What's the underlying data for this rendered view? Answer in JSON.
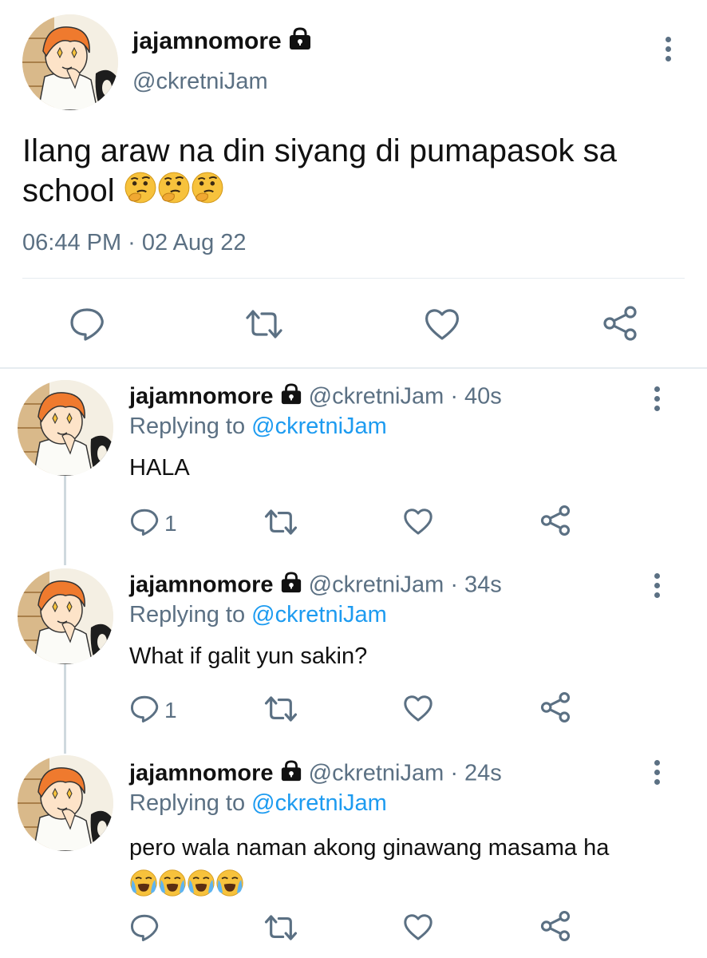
{
  "main_tweet": {
    "display_name": "jajamnomore",
    "handle": "@ckretniJam",
    "text_line1": "Ilang araw na din siyang di pumapasok sa",
    "text_line2": "school",
    "emoji": "thinking-face",
    "emoji_count": 3,
    "timestamp": "06:44 PM · 02 Aug 22",
    "actions": [
      "reply-icon",
      "retweet-icon",
      "like-icon",
      "share-icon"
    ]
  },
  "replies": [
    {
      "display_name": "jajamnomore",
      "meta": "@ckretniJam · 40s",
      "replying_prefix": "Replying to",
      "replying_handle": "@ckretniJam",
      "text": "HALA",
      "reply_count": "1"
    },
    {
      "display_name": "jajamnomore",
      "meta": "@ckretniJam · 34s",
      "replying_prefix": "Replying to",
      "replying_handle": "@ckretniJam",
      "text": "What if galit yun sakin?",
      "reply_count": "1"
    },
    {
      "display_name": "jajamnomore",
      "meta": "@ckretniJam · 24s",
      "replying_prefix": "Replying to",
      "replying_handle": "@ckretniJam",
      "text": "pero wala naman akong ginawang masama ha",
      "emoji": "loudly-crying-face",
      "emoji_count": 4
    }
  ],
  "colors": {
    "link": "#1d9bf0",
    "secondary_text": "#5b7083",
    "divider": "#e6ecf0",
    "emoji_yellow": "#f7c23c"
  }
}
